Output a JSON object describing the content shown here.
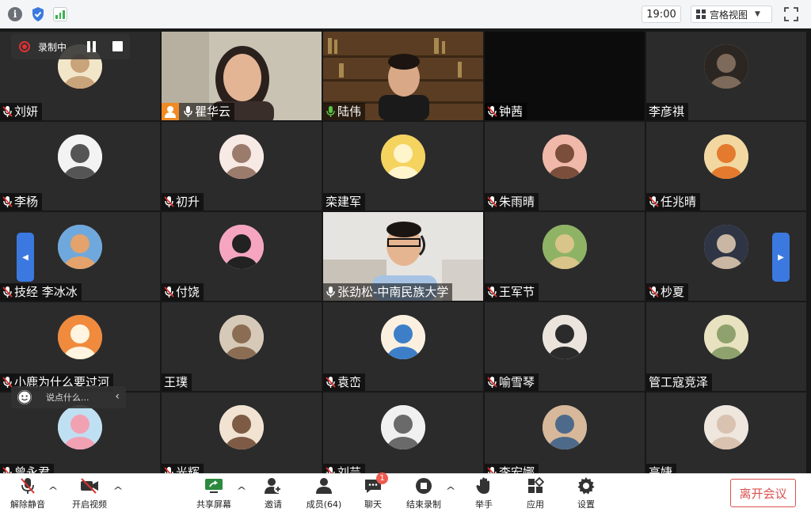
{
  "topbar": {
    "time": "19:00",
    "view_label": "宫格视图"
  },
  "recording": {
    "label": "录制中"
  },
  "chat_bubble": {
    "placeholder": "说点什么..."
  },
  "participants": [
    {
      "name": "刘妍",
      "muted": true
    },
    {
      "name": "瞿华云",
      "muted": false,
      "host": true,
      "video": true
    },
    {
      "name": "陆伟",
      "muted": false,
      "active": true,
      "video": true
    },
    {
      "name": "钟茜",
      "muted": true,
      "no_avatar": true
    },
    {
      "name": "李彦祺",
      "muted": null
    },
    {
      "name": "李杨",
      "muted": true
    },
    {
      "name": "初升",
      "muted": true
    },
    {
      "name": "栾建军",
      "muted": null
    },
    {
      "name": "朱雨晴",
      "muted": true
    },
    {
      "name": "任兆晴",
      "muted": true
    },
    {
      "name": "技经  李冰冰",
      "muted": true
    },
    {
      "name": "付饶",
      "muted": true
    },
    {
      "name": "张劲松-中南民族大学",
      "muted": false,
      "video": true
    },
    {
      "name": "王军节",
      "muted": true
    },
    {
      "name": "杪夏",
      "muted": true
    },
    {
      "name": "小鹿为什么要过河",
      "muted": true
    },
    {
      "name": "王璞",
      "muted": null
    },
    {
      "name": "袁峦",
      "muted": true
    },
    {
      "name": "喻雪琴",
      "muted": true
    },
    {
      "name": "管工寇竞泽",
      "muted": null
    },
    {
      "name": "曾永君",
      "muted": true
    },
    {
      "name": "光辉",
      "muted": true
    },
    {
      "name": "刘芸",
      "muted": true
    },
    {
      "name": "李宏娜",
      "muted": true
    },
    {
      "name": "高婕",
      "muted": null
    }
  ],
  "toolbar": {
    "unmute": "解除静音",
    "start_video": "开启视频",
    "share_screen": "共享屏幕",
    "invite": "邀请",
    "members": "成员(64)",
    "chat": "聊天",
    "chat_badge": "1",
    "stop_record": "结束录制",
    "raise_hand": "举手",
    "apps": "应用",
    "settings": "设置",
    "leave": "离开会议"
  },
  "colors": {
    "accent_blue": "#3b79e0",
    "active_green": "#59c24a",
    "leave_red": "#d9534f",
    "record_red": "#e03131",
    "badge_red": "#ef5a50"
  }
}
